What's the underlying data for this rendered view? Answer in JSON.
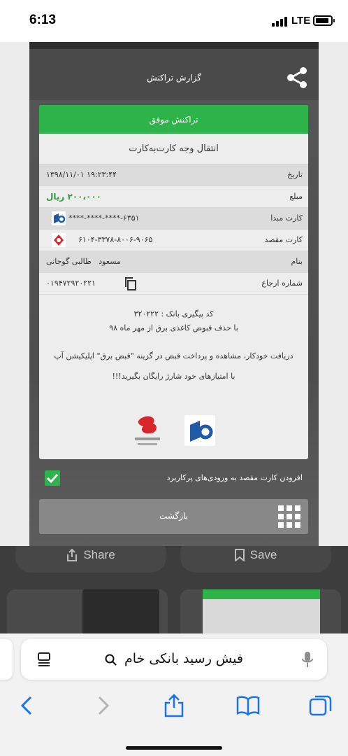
{
  "status_bar": {
    "time": "6:13",
    "network": "LTE"
  },
  "receipt_app": {
    "header_title": "گزارش تراکنش",
    "success_label": "تراکنش موفق",
    "receipt_title": "انتقال وجه کارت‌به‌کارت",
    "rows": [
      {
        "label": "تاریخ",
        "value": "۱۳۹۸/۱۱/۰۱ ۱۹:۲۳:۴۴"
      },
      {
        "label": "مبلغ",
        "value": "۲۰۰،۰۰۰ ریال"
      },
      {
        "label": "کارت مبدا",
        "value": "****-****-****-۶۳۵۱"
      },
      {
        "label": "کارت مقصد",
        "value": "۶۱۰۴-۳۳۷۸-۸۰۰۶-۹۰۶۵"
      },
      {
        "label": "بنام",
        "value": "مسعود   طالبی گوجانی"
      },
      {
        "label": "شماره ارجاع",
        "value": "۰۱۹۴۷۲۹۲۰۲۲۱"
      }
    ],
    "tracking_code": "کد پیگیری بانک : ۳۲۰۲۲۲",
    "bill_notice": "با حذف قبوض کاغذی برق از مهر ماه ۹۸",
    "bill_info": "دریافت خودکار، مشاهده و پرداخت قبض در گزینه \"قبض برق\" اپلیکیشن آپ",
    "promo": "با امتیازهای خود شارژ رایگان بگیرید!!!",
    "add_card_label": "افزودن کارت مقصد به ورودی‌های پرکاربرد",
    "back_label": "بازگشت",
    "accent_green": "#2db34a"
  },
  "overlay": {
    "share_label": "Share",
    "save_label": "Save"
  },
  "safari": {
    "search_text": "فیش رسید بانکی خام",
    "toolbar": [
      "back-icon",
      "forward-icon",
      "share-icon",
      "bookmarks-icon",
      "tabs-icon"
    ]
  }
}
